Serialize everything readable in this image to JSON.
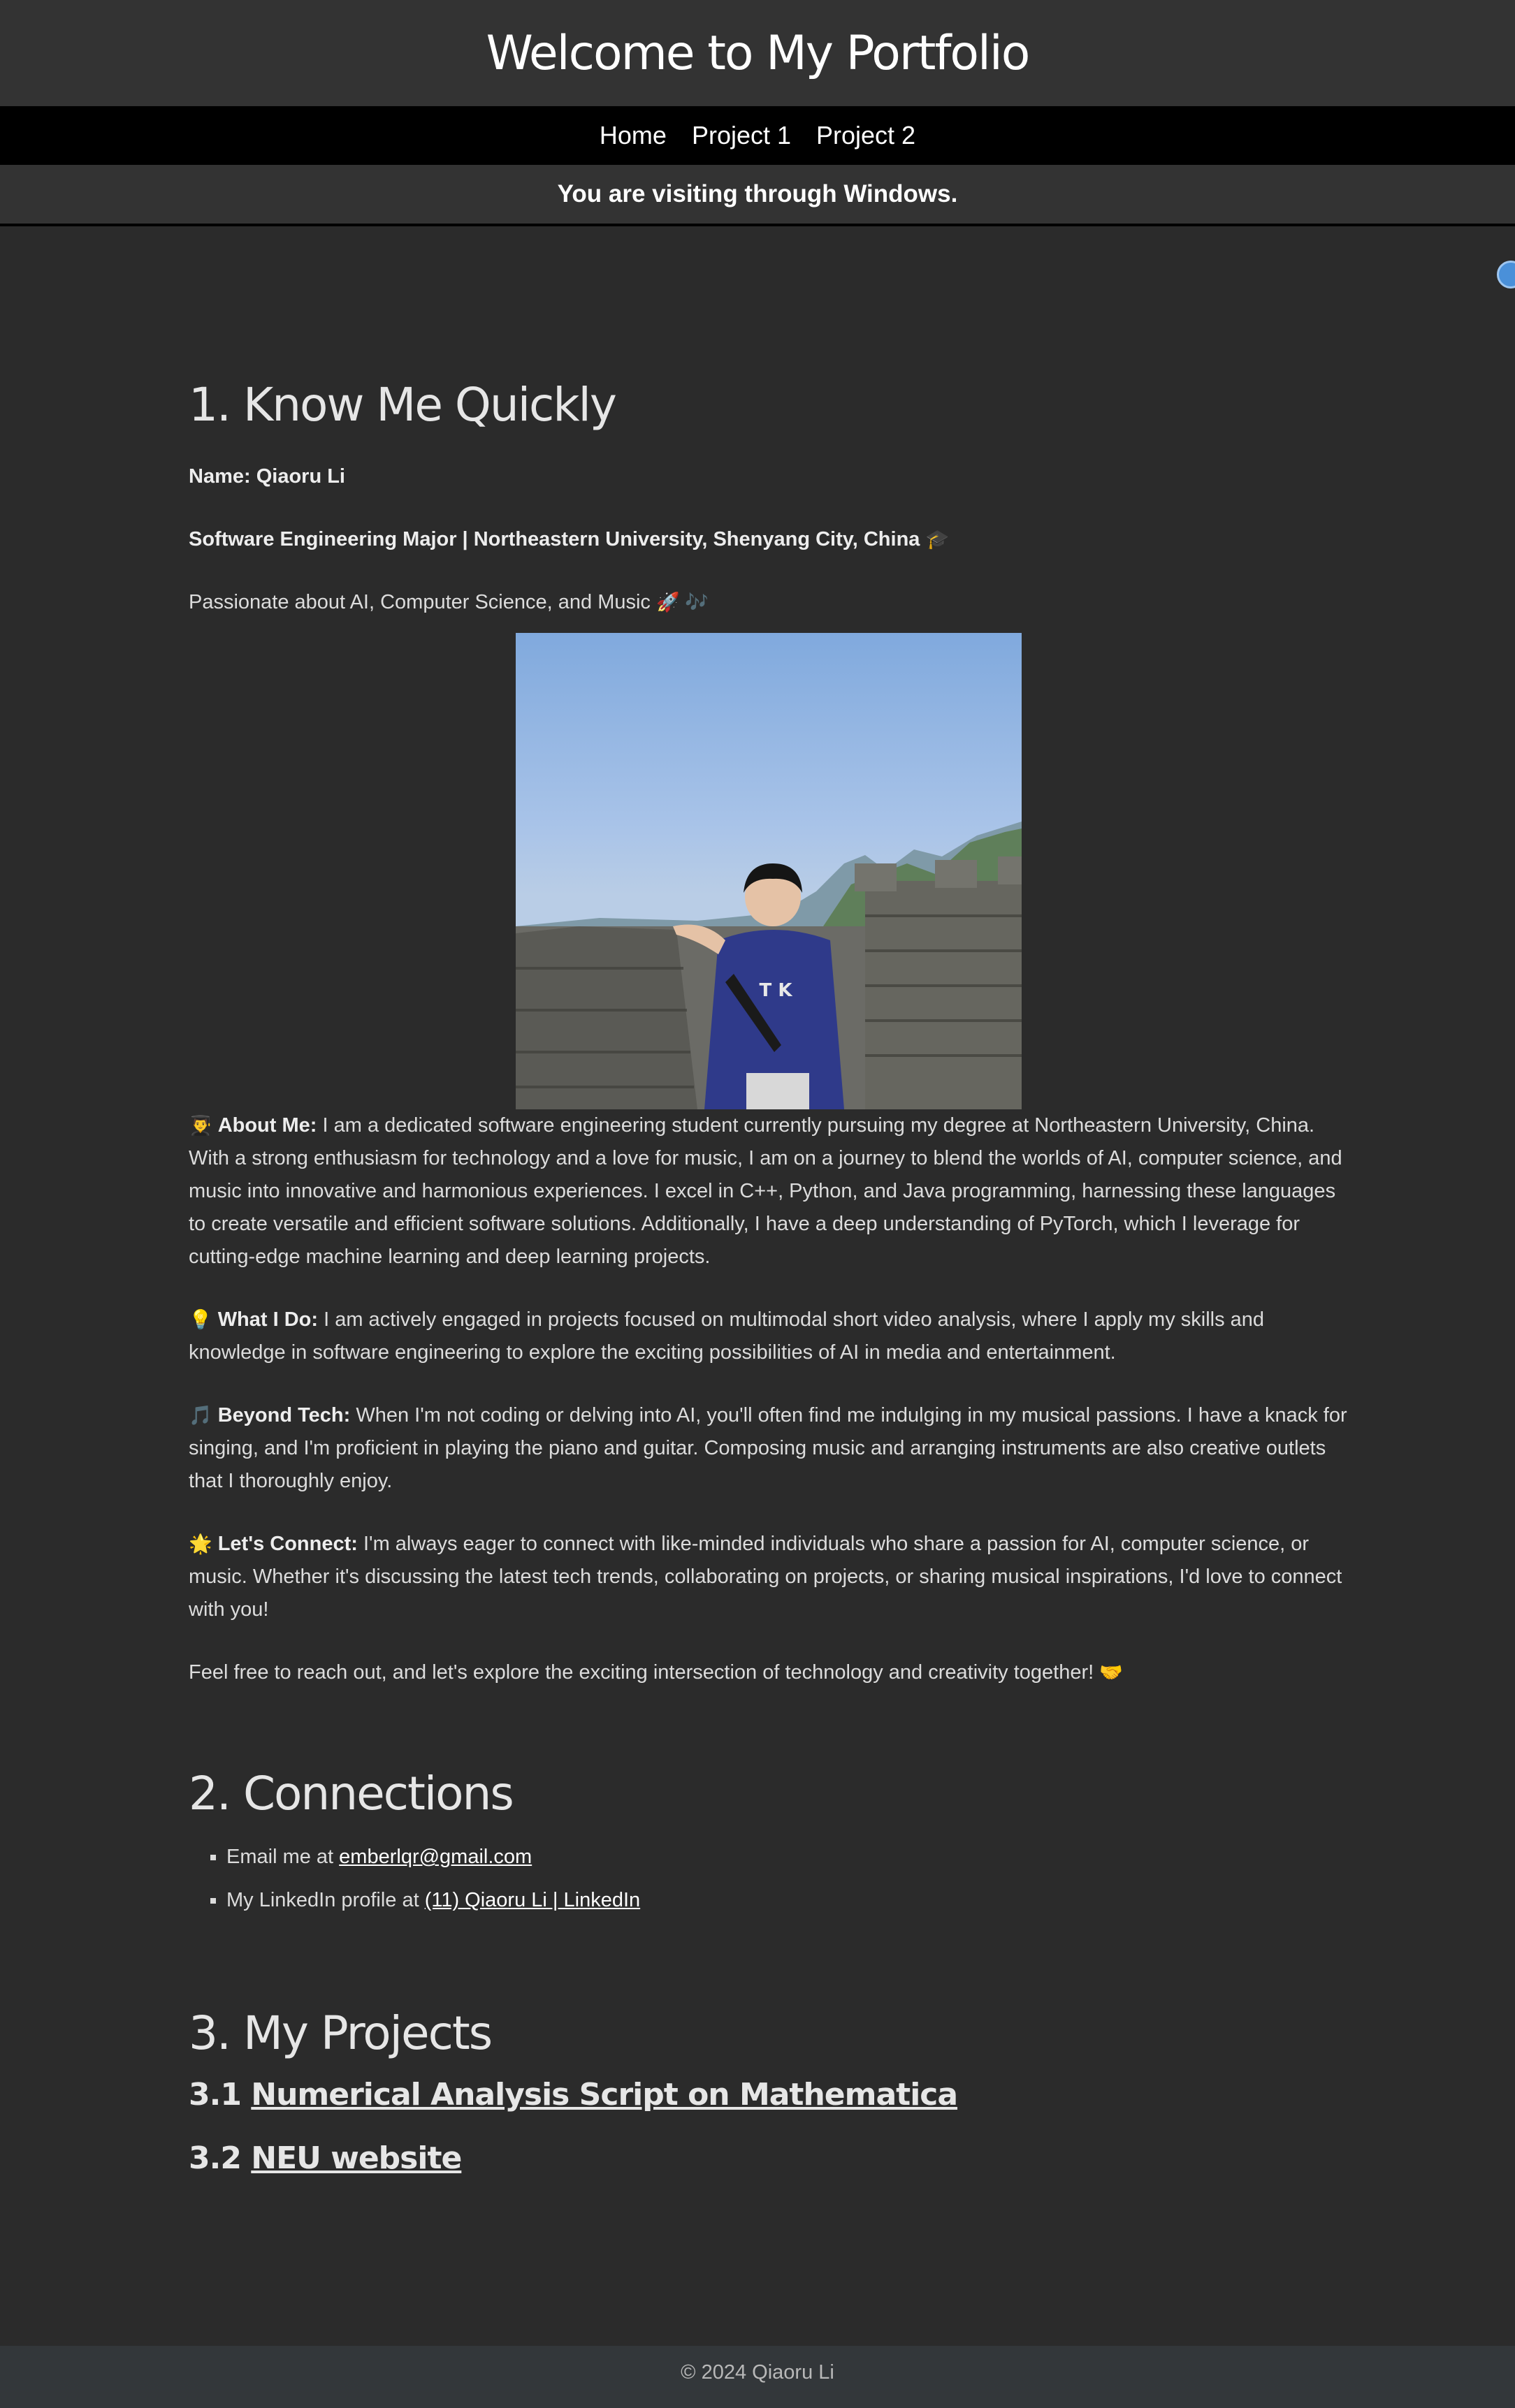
{
  "header": {
    "title": "Welcome to My Portfolio"
  },
  "nav": {
    "items": [
      "Home",
      "Project 1",
      "Project 2"
    ]
  },
  "platform": {
    "message": "You are visiting through Windows."
  },
  "about": {
    "heading": "1. Know Me Quickly",
    "name": "Name: Qiaoru Li",
    "major": "Software Engineering Major | Northeastern University, Shenyang City, China",
    "major_emoji": "🎓",
    "passion": "Passionate about AI, Computer Science, and Music",
    "passion_emoji": "🚀 🎶",
    "about_emoji": "👨‍🎓",
    "about_label": "About Me:",
    "about_text": " I am a dedicated software engineering student currently pursuing my degree at Northeastern University, China. With a strong enthusiasm for technology and a love for music, I am on a journey to blend the worlds of AI, computer science, and music into innovative and harmonious experiences. I excel in C++, Python, and Java programming, harnessing these languages to create versatile and efficient software solutions. Additionally, I have a deep understanding of PyTorch, which I leverage for cutting-edge machine learning and deep learning projects.",
    "do_emoji": "💡",
    "do_label": "What I Do:",
    "do_text": " I am actively engaged in projects focused on multimodal short video analysis, where I apply my skills and knowledge in software engineering to explore the exciting possibilities of AI in media and entertainment.",
    "beyond_emoji": "🎵",
    "beyond_label": "Beyond Tech:",
    "beyond_text": " When I'm not coding or delving into AI, you'll often find me indulging in my musical passions. I have a knack for singing, and I'm proficient in playing the piano and guitar. Composing music and arranging instruments are also creative outlets that I thoroughly enjoy.",
    "connect_emoji": "🌟",
    "connect_label": "Let's Connect:",
    "connect_text": " I'm always eager to connect with like-minded individuals who share a passion for AI, computer science, or music. Whether it's discussing the latest tech trends, collaborating on projects, or sharing musical inspirations, I'd love to connect with you!",
    "closing": "Feel free to reach out, and let's explore the exciting intersection of technology and creativity together!",
    "closing_emoji": "🤝"
  },
  "connections": {
    "heading": "2. Connections",
    "email_prefix": "Email me at ",
    "email_link": "emberlqr@gmail.com",
    "linkedin_prefix": "My LinkedIn profile at ",
    "linkedin_link": "(11) Qiaoru Li | LinkedIn"
  },
  "projects": {
    "heading": "3. My Projects",
    "items": [
      {
        "number": "3.1 ",
        "title": "Numerical Analysis Script on Mathematica"
      },
      {
        "number": "3.2 ",
        "title": "NEU website"
      }
    ]
  },
  "footer": {
    "text": "© 2024 Qiaoru Li"
  }
}
